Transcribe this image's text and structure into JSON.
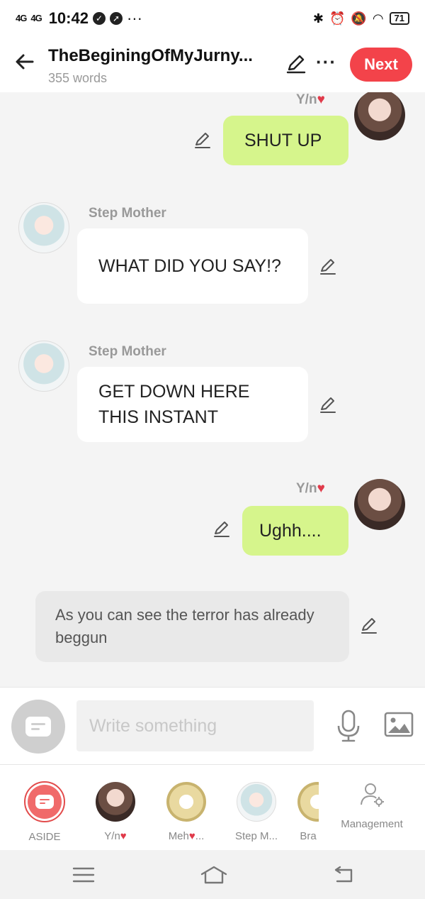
{
  "status_bar": {
    "signal1": "4G",
    "signal2": "4G",
    "time": "10:42",
    "more": "···",
    "battery": "71"
  },
  "header": {
    "back_icon": "arrow-left-icon",
    "title": "TheBeginingOfMyJurny...",
    "word_count": "355 words",
    "edit_icon": "pencil-icon",
    "more_label": "···",
    "next_label": "Next"
  },
  "messages": [
    {
      "type": "me",
      "speaker": "Y/n",
      "text": "SHUT UP"
    },
    {
      "type": "other",
      "speaker": "Step Mother",
      "text": "WHAT DID YOU SAY!?"
    },
    {
      "type": "other",
      "speaker": "Step Mother",
      "text": "GET DOWN HERE THIS INSTANT"
    },
    {
      "type": "me",
      "speaker": "Y/n",
      "text": "Ughh...."
    },
    {
      "type": "aside",
      "text": "As you can see the terror has already beggun"
    }
  ],
  "input": {
    "placeholder": "Write something",
    "mic_icon": "microphone-icon",
    "image_icon": "image-icon"
  },
  "characters": [
    {
      "label": "ASIDE"
    },
    {
      "label": "Y/n"
    },
    {
      "label": "Meh"
    },
    {
      "label": "Step M..."
    },
    {
      "label": "Bra"
    }
  ],
  "management_label": "Management",
  "colors": {
    "accent": "#f3434a",
    "my_bubble": "#d6f58c",
    "other_bubble": "#ffffff",
    "aside_bubble": "#e9e9e9"
  }
}
